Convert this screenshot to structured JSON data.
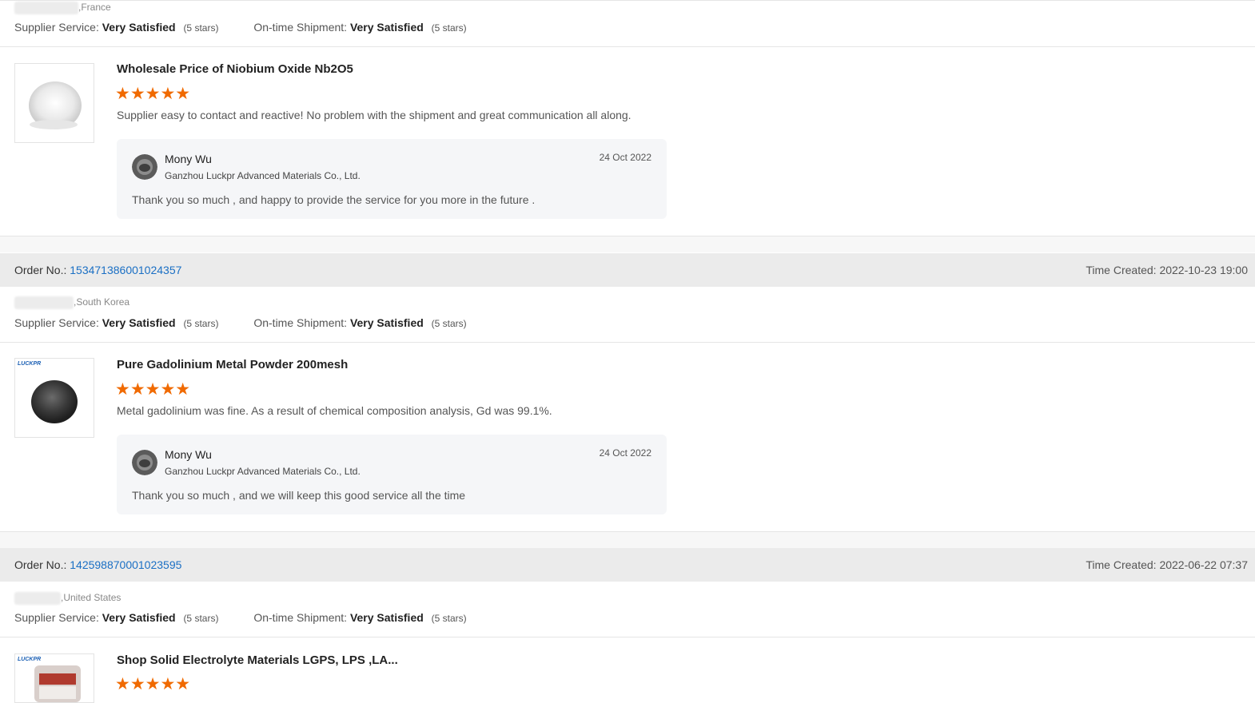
{
  "orders": [
    {
      "order_label": "",
      "order_number": "",
      "time_label": "",
      "time_value": "",
      "buyer_country": ",France",
      "supplier_service_label": "Supplier Service:",
      "supplier_service_value": "Very Satisfied",
      "supplier_service_stars": "(5 stars)",
      "shipment_label": "On-time Shipment:",
      "shipment_value": "Very Satisfied",
      "shipment_stars": "(5 stars)",
      "product_title": "Wholesale Price of Niobium Oxide Nb2O5",
      "rating": 5,
      "review": "Supplier easy to contact and reactive! No problem with the shipment and great communication all along.",
      "reply": {
        "name": "Mony Wu",
        "company": "Ganzhou Luckpr Advanced Materials Co., Ltd.",
        "date": "24 Oct 2022",
        "text": "Thank you so much , and happy to provide the service for you more in the future ."
      }
    },
    {
      "order_label": "Order No.:",
      "order_number": "153471386001024357",
      "time_label": "Time Created:",
      "time_value": "2022-10-23 19:00",
      "buyer_country": ",South Korea",
      "supplier_service_label": "Supplier Service:",
      "supplier_service_value": "Very Satisfied",
      "supplier_service_stars": "(5 stars)",
      "shipment_label": "On-time Shipment:",
      "shipment_value": "Very Satisfied",
      "shipment_stars": "(5 stars)",
      "product_title": "Pure Gadolinium Metal Powder 200mesh",
      "rating": 5,
      "review": "Metal gadolinium was fine. As a result of chemical composition analysis, Gd was 99.1%.",
      "reply": {
        "name": "Mony Wu",
        "company": "Ganzhou Luckpr Advanced Materials Co., Ltd.",
        "date": "24 Oct 2022",
        "text": "Thank you so much , and we will keep this good service all the time"
      }
    },
    {
      "order_label": "Order No.:",
      "order_number": "142598870001023595",
      "time_label": "Time Created:",
      "time_value": "2022-06-22 07:37",
      "buyer_country": ",United States",
      "supplier_service_label": "Supplier Service:",
      "supplier_service_value": "Very Satisfied",
      "supplier_service_stars": "(5 stars)",
      "shipment_label": "On-time Shipment:",
      "shipment_value": "Very Satisfied",
      "shipment_stars": "(5 stars)",
      "product_title": "Shop Solid Electrolyte Materials LGPS, LPS ,LA...",
      "rating": 5
    }
  ],
  "thumb_logo_text": "LUCKPR",
  "star_glyph": "★★★★★",
  "colors": {
    "star": "#f06a00",
    "link": "#1a6fc4",
    "order_bar": "#ebebeb",
    "reply_bg": "#f5f6f8"
  }
}
